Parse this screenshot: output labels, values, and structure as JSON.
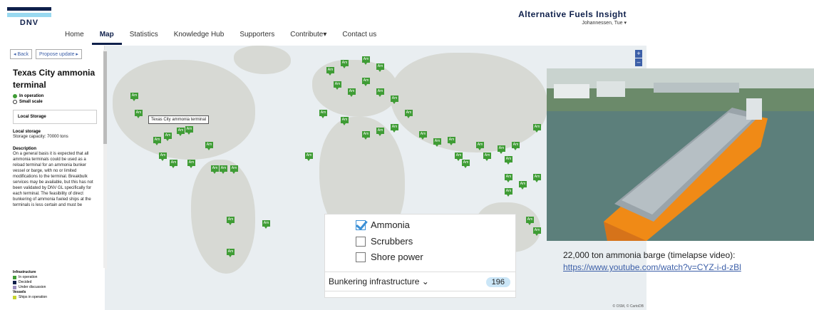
{
  "header": {
    "logo_text": "DNV",
    "brand": "Alternative Fuels Insight",
    "user": "Johannessen, Tue ▾"
  },
  "nav": {
    "items": [
      "Home",
      "Map",
      "Statistics",
      "Knowledge Hub",
      "Supporters",
      "Contribute▾",
      "Contact us"
    ],
    "active": "Map"
  },
  "sidebar": {
    "back": "◂ Back",
    "propose": "Propose update ▸",
    "title": "Texas City ammonia terminal",
    "status_in_operation": "In operation",
    "status_small_scale": "Small scale",
    "local_storage_box": "Local Storage",
    "local_storage_heading": "Local storage",
    "storage_capacity": "Storage capacity: 70000 tons",
    "description_heading": "Description",
    "description": "On a general basis it is expected that all ammonia terminals could be used as a reload terminal for an ammonia bunker vessel or barge, with no or limited modifications to the terminal. Breakbulk services may be available, but this has not been validated by DNV GL specifically for each terminal. The feasibility of direct bunkering of ammonia fueled ships at the terminals is less certain and must be"
  },
  "legend": {
    "infrastructure_title": "Infrastructure",
    "in_operation": "In operation",
    "decided": "Decided",
    "under_discussion": "Under discussion",
    "vessels_title": "Vessels",
    "ships_in_operation": "Ships in operation",
    "colors": {
      "in_operation": "#3f9c35",
      "decided": "#0f204b",
      "under_discussion": "#9c8fbf",
      "ships": "#c7d42e"
    }
  },
  "map": {
    "pin_label": "Am",
    "tooltip": "Texas City ammonia terminal",
    "zoom_in": "+",
    "zoom_out": "–",
    "attribution": "© OSM, © CartoDB"
  },
  "filter_panel": {
    "options": [
      {
        "label": "Ammonia",
        "checked": true
      },
      {
        "label": "Scrubbers",
        "checked": false
      },
      {
        "label": "Shore power",
        "checked": false
      }
    ],
    "dropdown_label": "Bunkering infrastructure ⌄",
    "count": "196"
  },
  "photo": {
    "caption": "22,000 ton ammonia barge (timelapse video):",
    "link": "https://www.youtube.com/watch?v=CYZ-i-d-zBl"
  }
}
